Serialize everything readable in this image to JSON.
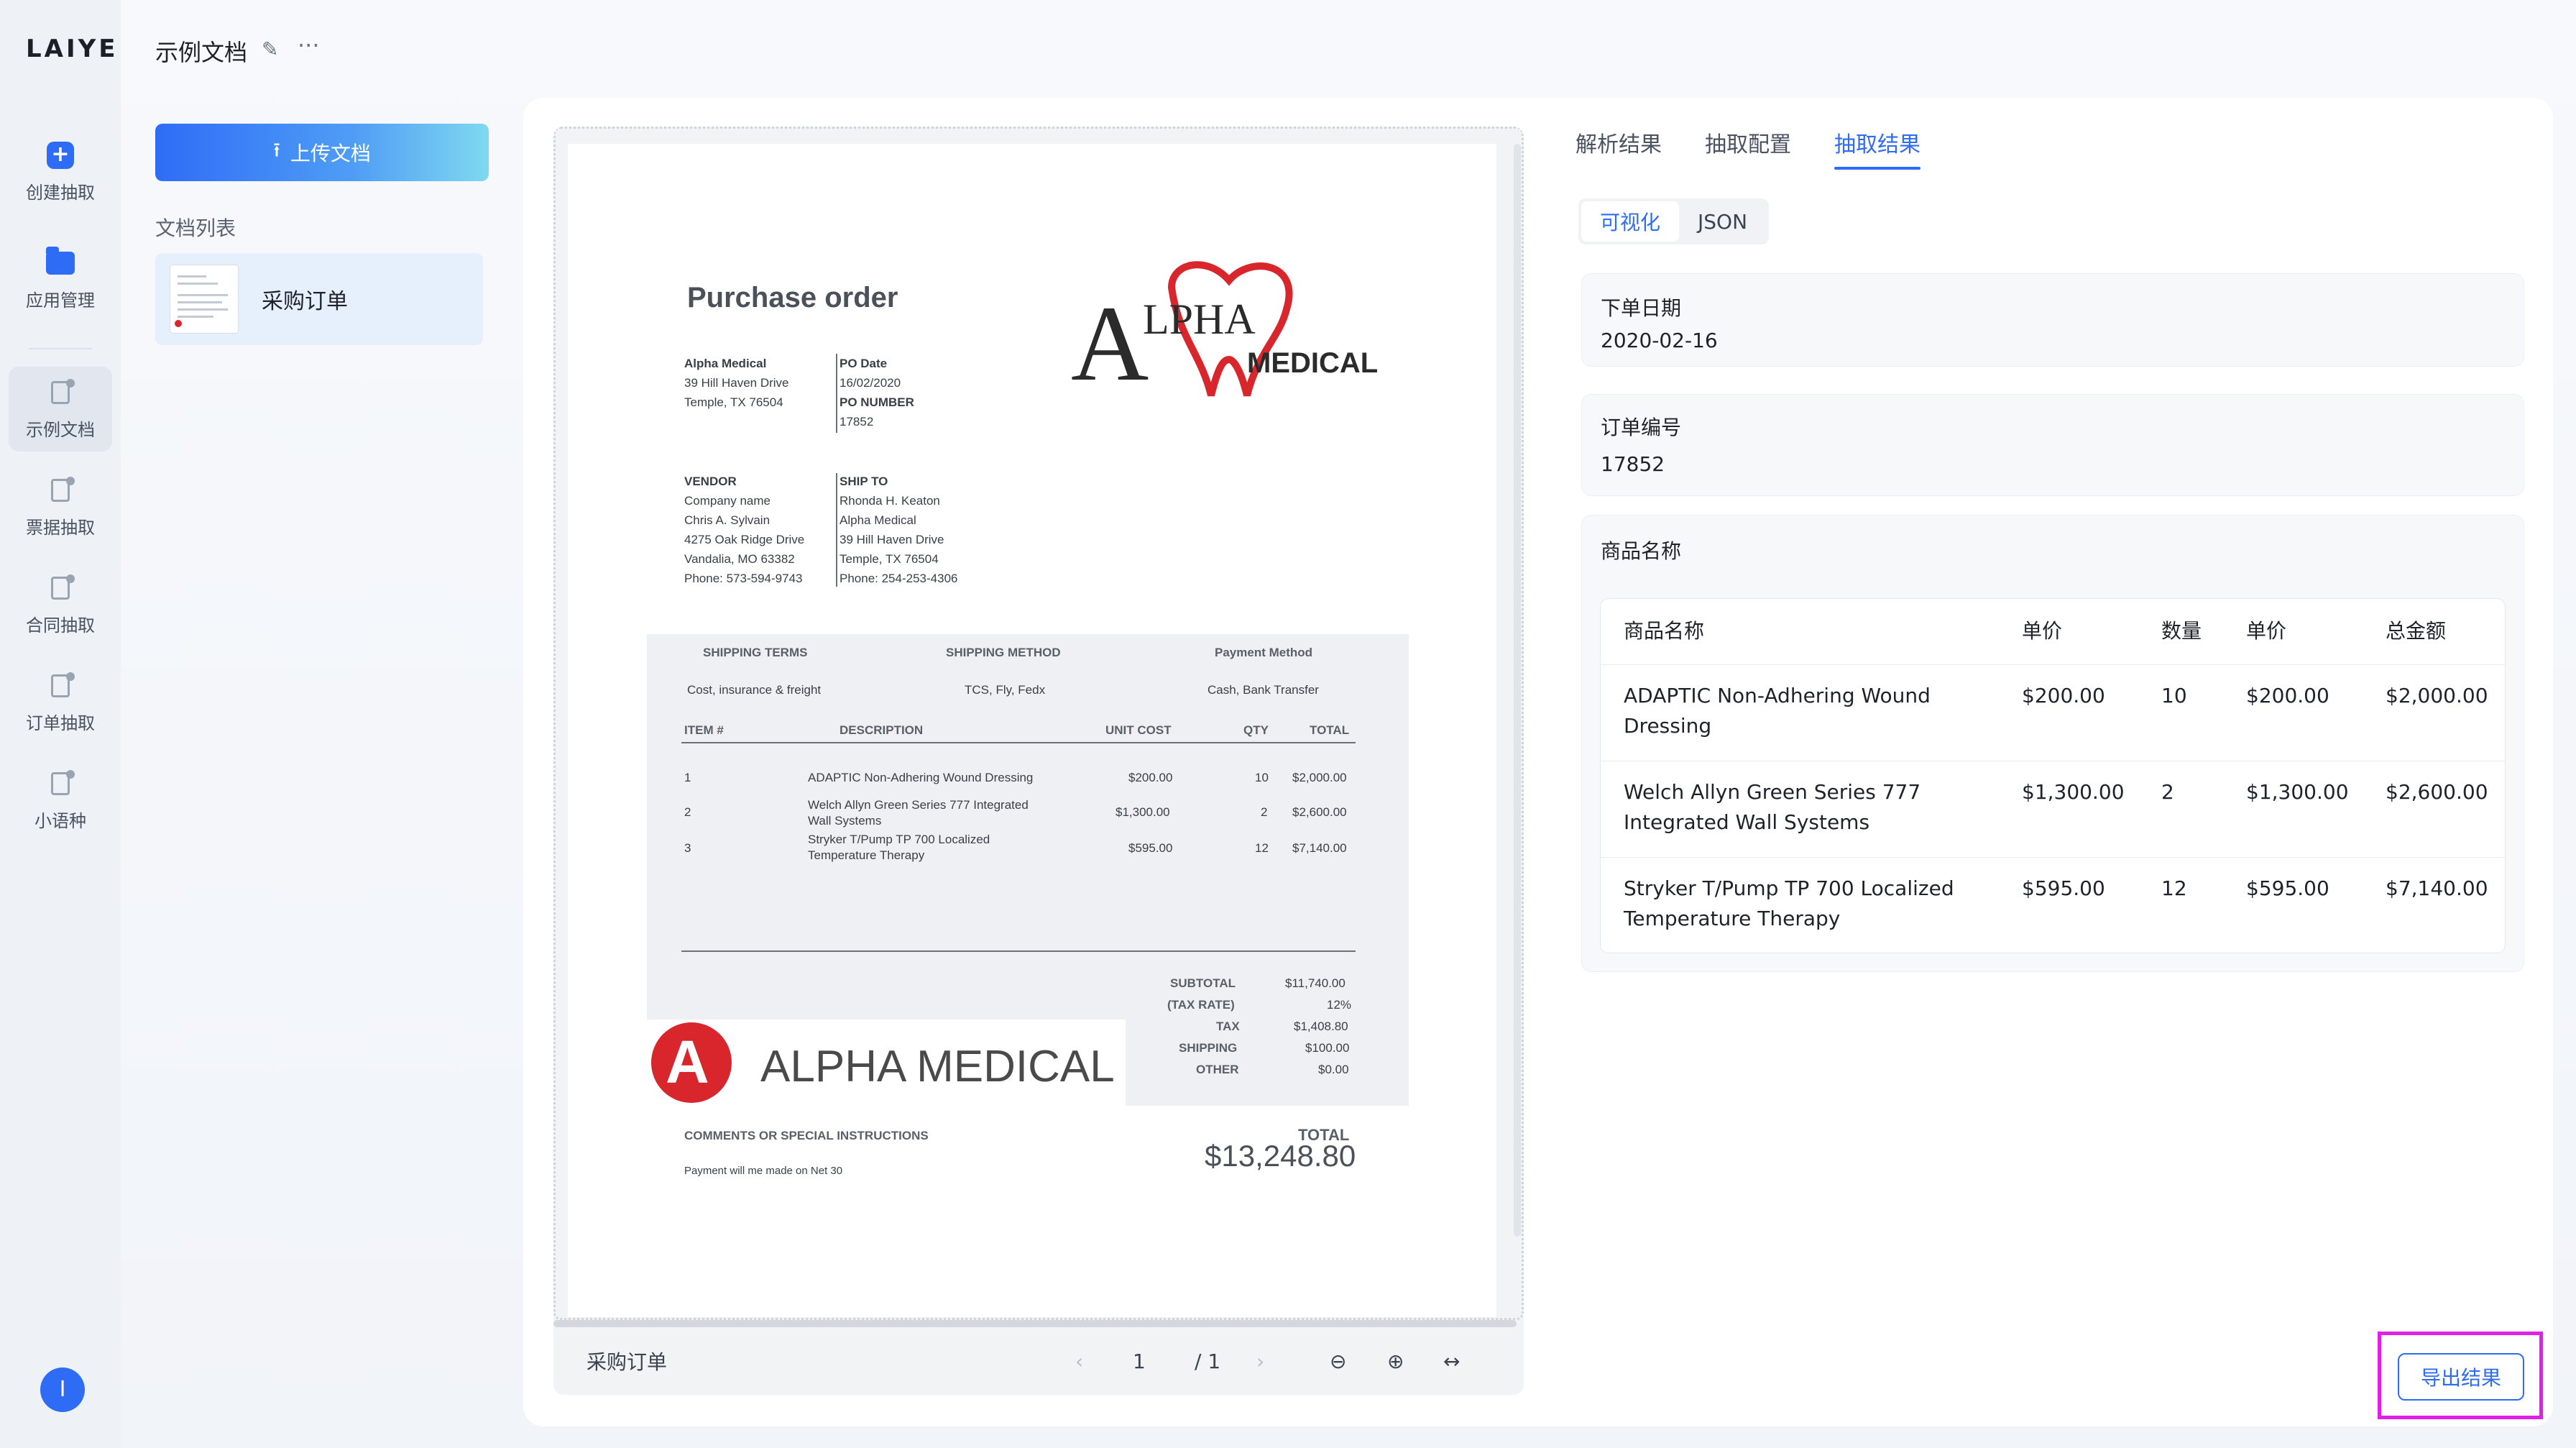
{
  "app": {
    "logo": "LAIYE"
  },
  "rail": {
    "items": [
      {
        "label": "创建抽取",
        "icon": "plus-icon"
      },
      {
        "label": "应用管理",
        "icon": "folder-icon"
      },
      {
        "label": "示例文档",
        "icon": "doc-edit-icon"
      },
      {
        "label": "票据抽取",
        "icon": "doc-edit-icon"
      },
      {
        "label": "合同抽取",
        "icon": "doc-edit-icon"
      },
      {
        "label": "订单抽取",
        "icon": "doc-edit-icon"
      },
      {
        "label": "小语种",
        "icon": "doc-edit-icon"
      }
    ],
    "avatar": "I"
  },
  "header": {
    "title": "示例文档",
    "edit_icon": "pencil-icon",
    "more": "···"
  },
  "docs_panel": {
    "upload_label": "上传文档",
    "list_label": "文档列表",
    "items": [
      {
        "name": "采购订单"
      }
    ]
  },
  "viewer": {
    "footer_name": "采购订单",
    "prev": "‹",
    "page": "1",
    "total": "/ 1",
    "next": "›",
    "zoom_out": "⊖",
    "zoom_in": "⊕",
    "fit": "↔"
  },
  "document": {
    "title": "Purchase order",
    "from": [
      "Alpha Medical",
      "39 Hill Haven Drive",
      "Temple, TX 76504"
    ],
    "po_date_label": "PO Date",
    "po_date": "16/02/2020",
    "po_number_label": "PO NUMBER",
    "po_number": "17852",
    "vendor_label": "VENDOR",
    "vendor": [
      "Company name",
      "Chris A. Sylvain",
      "4275 Oak Ridge Drive",
      "Vandalia, MO 63382",
      "Phone: 573-594-9743"
    ],
    "ship_to_label": "SHIP TO",
    "ship_to": [
      "Rhonda H. Keaton",
      "Alpha Medical",
      "39 Hill Haven Drive",
      "Temple, TX 76504",
      "Phone: 254-253-4306"
    ],
    "shipping_terms_label": "SHIPPING TERMS",
    "shipping_terms": "Cost, insurance & freight",
    "shipping_method_label": "SHIPPING METHOD",
    "shipping_method": "TCS, Fly, Fedx",
    "payment_method_label": "Payment Method",
    "payment_method": "Cash, Bank Transfer",
    "columns": [
      "ITEM #",
      "DESCRIPTION",
      "UNIT COST",
      "QTY",
      "TOTAL"
    ],
    "lines": [
      {
        "item": "1",
        "desc": "ADAPTIC Non-Adhering Wound Dressing",
        "desc2": "",
        "unit": "$200.00",
        "qty": "10",
        "total": "$2,000.00"
      },
      {
        "item": "2",
        "desc": "Welch Allyn Green Series 777 Integrated",
        "desc2": "Wall Systems",
        "unit": "$1,300.00",
        "qty": "2",
        "total": "$2,600.00"
      },
      {
        "item": "3",
        "desc": "Stryker T/Pump TP 700 Localized",
        "desc2": "Temperature Therapy",
        "unit": "$595.00",
        "qty": "12",
        "total": "$7,140.00"
      }
    ],
    "summary": [
      {
        "label": "SUBTOTAL",
        "value": "$11,740.00"
      },
      {
        "label": "(TAX RATE)",
        "value": "12%"
      },
      {
        "label": "TAX",
        "value": "$1,408.80"
      },
      {
        "label": "SHIPPING",
        "value": "$100.00"
      },
      {
        "label": "OTHER",
        "value": "$0.00"
      }
    ],
    "comments_label": "COMMENTS OR SPECIAL INSTRUCTIONS",
    "comments": "Payment will me made on Net 30",
    "total_label": "TOTAL",
    "total": "$13,248.80",
    "logo_small_letter": "A",
    "logo_top_text": "LPHA",
    "logo_sub_text": "MEDICAL",
    "logo_bottom_text": "ALPHA MEDICAL",
    "logo_bottom_letter": "A"
  },
  "results": {
    "tabs": [
      {
        "label": "解析结果",
        "active": false
      },
      {
        "label": "抽取配置",
        "active": false
      },
      {
        "label": "抽取结果",
        "active": true
      }
    ],
    "views": [
      {
        "label": "可视化",
        "active": true
      },
      {
        "label": "JSON",
        "active": false
      }
    ],
    "fields": [
      {
        "label": "下单日期",
        "value": "2020-02-16"
      },
      {
        "label": "订单编号",
        "value": "17852"
      }
    ],
    "items_label": "商品名称",
    "items_columns": [
      "商品名称",
      "单价",
      "数量",
      "单价",
      "总金额"
    ],
    "items": [
      {
        "name": "ADAPTIC Non-Adhering Wound",
        "name2": "Dressing",
        "price": "$200.00",
        "qty": "10",
        "unit": "$200.00",
        "total": "$2,000.00"
      },
      {
        "name": "Welch Allyn Green Series 777",
        "name2": "Integrated Wall Systems",
        "price": "$1,300.00",
        "qty": "2",
        "unit": "$1,300.00",
        "total": "$2,600.00"
      },
      {
        "name": "Stryker T/Pump TP 700 Localized",
        "name2": "Temperature Therapy",
        "price": "$595.00",
        "qty": "12",
        "unit": "$595.00",
        "total": "$7,140.00"
      }
    ],
    "export_label": "导出结果"
  },
  "colors": {
    "accent": "#2e6cf6",
    "highlight": "#e21fe6",
    "logo_red": "#d9262c"
  }
}
